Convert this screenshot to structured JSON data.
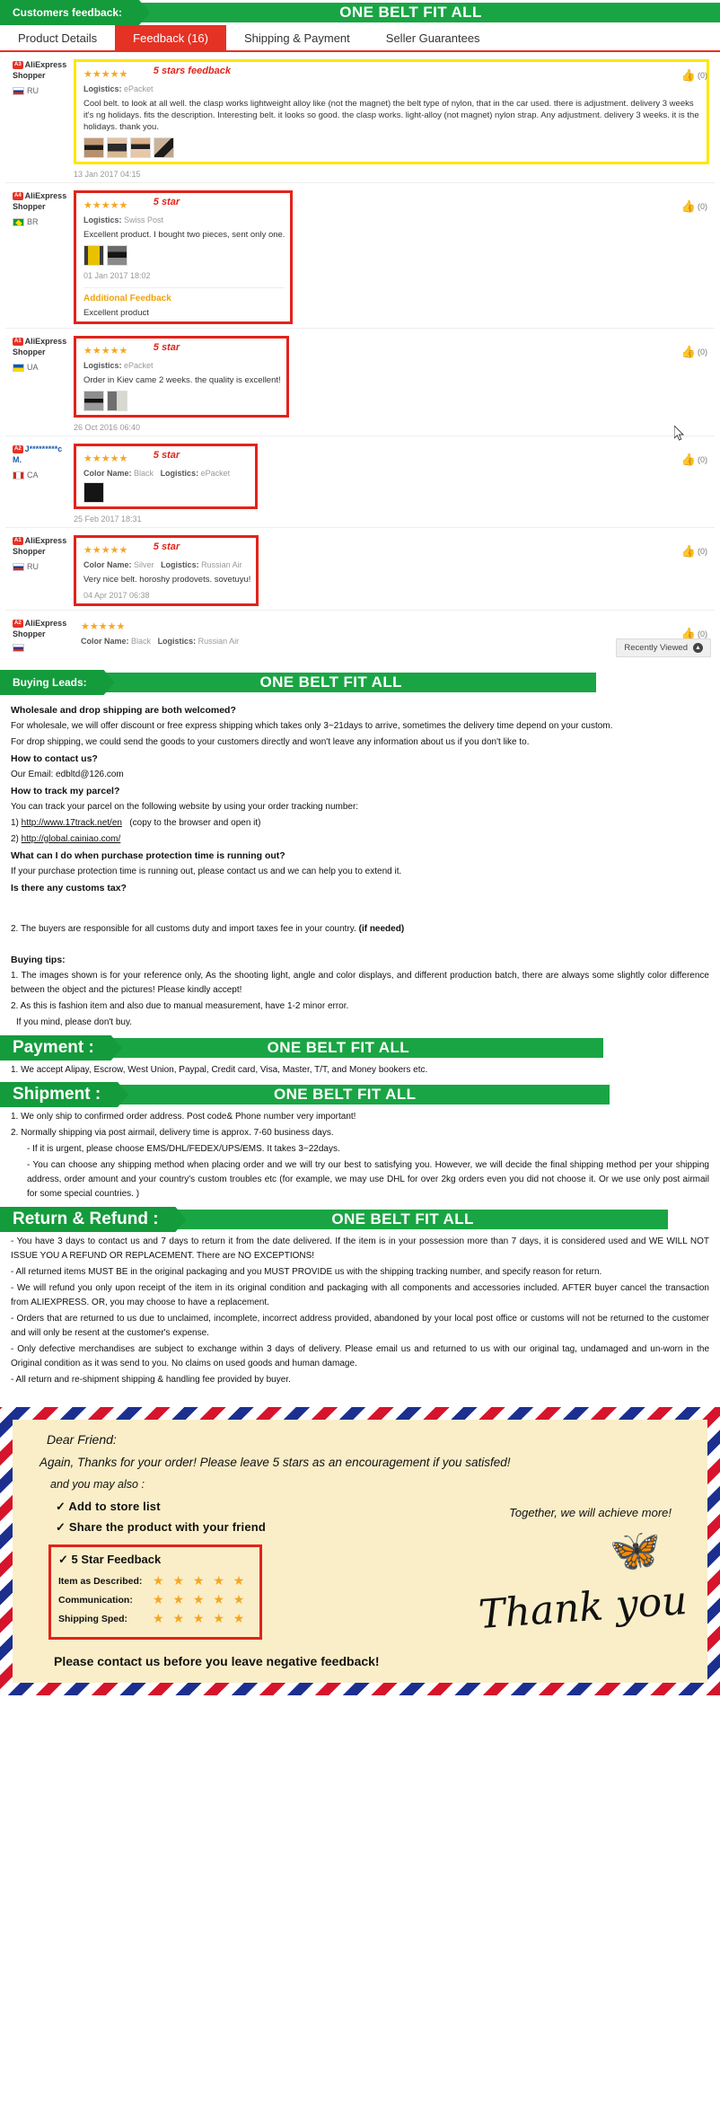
{
  "header": {
    "banner_label": "Customers feedback:",
    "banner_slogan": "ONE BELT FIT ALL"
  },
  "tabs": [
    {
      "label": "Product Details",
      "active": false
    },
    {
      "label": "Feedback (16)",
      "active": true
    },
    {
      "label": "Shipping & Payment",
      "active": false
    },
    {
      "label": "Seller Guarantees",
      "active": false
    }
  ],
  "feedback": [
    {
      "badge": "A3",
      "user": "AliExpress",
      "user2": "Shopper",
      "country": "RU",
      "flag": "flag-ru",
      "stars": "★★★★★",
      "note": "5 stars feedback",
      "meta_label": "Logistics:",
      "meta_value": "ePacket",
      "text": "Cool belt. to look at all well. the clasp works lightweight alloy like (not the magnet) the belt type of nylon, that in the car used. there is adjustment. delivery 3 weeks it's ng holidays. fits the description. Interesting belt. it looks so good. the clasp works. light-alloy (not magnet) nylon strap. Any adjustment. delivery 3 weeks. it is the holidays. thank you.",
      "date": "13 Jan 2017 04:15",
      "helpful": "(0)"
    },
    {
      "badge": "A4",
      "user": "AliExpress",
      "user2": "Shopper",
      "country": "BR",
      "flag": "flag-br",
      "stars": "★★★★★",
      "note": "5 star",
      "meta_label": "Logistics:",
      "meta_value": "Swiss Post",
      "text": "Excellent product. I bought two pieces, sent only one.",
      "date": "01 Jan 2017 18:02",
      "additional_label": "Additional Feedback",
      "additional_text": "Excellent product",
      "helpful": "(0)"
    },
    {
      "badge": "A1",
      "user": "AliExpress",
      "user2": "Shopper",
      "country": "UA",
      "flag": "flag-ua",
      "stars": "★★★★★",
      "note": "5 star",
      "meta_label": "Logistics:",
      "meta_value": "ePacket",
      "text": "Order in Kiev came 2 weeks. the quality is excellent!",
      "date": "26 Oct 2016 06:40",
      "helpful": "(0)"
    },
    {
      "badge": "A2",
      "user": "J*********c",
      "user2": "M.",
      "country": "CA",
      "flag": "flag-ca",
      "stars": "★★★★★",
      "note": "5 star",
      "meta_label": "Color Name:",
      "meta_value": "Black",
      "meta_label2": "Logistics:",
      "meta_value2": "ePacket",
      "text": "",
      "date": "25 Feb 2017 18:31",
      "helpful": "(0)"
    },
    {
      "badge": "A1",
      "user": "AliExpress",
      "user2": "Shopper",
      "country": "RU",
      "flag": "flag-ru",
      "stars": "★★★★★",
      "note": "5 star",
      "meta_label": "Color Name:",
      "meta_value": "Silver",
      "meta_label2": "Logistics:",
      "meta_value2": "Russian Air",
      "text": "Very nice belt. horoshy prodovets. sovetuyu!",
      "date": "04 Apr 2017 06:38",
      "helpful": "(0)"
    },
    {
      "badge": "A2",
      "user": "AliExpress",
      "user2": "Shopper",
      "country": "",
      "flag": "flag-ru",
      "stars": "★★★★★",
      "note": "",
      "meta_label": "Color Name:",
      "meta_value": "Black",
      "meta_label2": "Logistics:",
      "meta_value2": "Russian Air",
      "text": "",
      "date": "",
      "helpful": "(0)"
    }
  ],
  "recently_viewed": {
    "label": "Recently Viewed",
    "icon": "up-caret-circle"
  },
  "buying_leads": {
    "banner_label": "Buying Leads:",
    "banner_slogan": "ONE BELT FIT ALL",
    "q1": "Wholesale and drop shipping are both welcomed?",
    "p1": "For wholesale, we will offer discount or free express shipping which takes only 3~21days to arrive, sometimes the delivery time depend on your custom.",
    "p2": "For drop shipping, we could send the goods to your customers directly and won't leave any information about us if you don't like to.",
    "q2": "How to contact us?",
    "p3": "Our Email: edbltd@126.com",
    "q3": "How to track my parcel?",
    "p4": "You can track your parcel on the following website by using your order tracking number:",
    "link1_prefix": "1) ",
    "link1": "http://www.17track.net/en",
    "link1_suffix": "(copy to the browser and open it)",
    "link2_prefix": "2) ",
    "link2": "http://global.cainiao.com/",
    "q4": "What can I do when purchase protection time is running out?",
    "p5": "If your purchase protection time is running out, please contact us and we can help you to extend it.",
    "q5": "Is there any customs tax?",
    "p6": "2. The buyers are responsible for all customs duty and import taxes fee in your country.",
    "p6_bold": "(if needed)",
    "q6": "Buying tips:",
    "p7": "1. The images shown is for your reference only, As the shooting light, angle and color displays, and different production batch, there are always some slightly color difference between the object and the pictures! Please kindly accept!",
    "p8": "2. As this is fashion item and also due to manual measurement, have 1-2 minor error.",
    "p9": "If you mind, please don't buy."
  },
  "payment": {
    "banner_label": "Payment :",
    "banner_slogan": "ONE BELT FIT ALL",
    "p1": "1. We accept Alipay, Escrow, West Union, Paypal, Credit card, Visa, Master, T/T, and Money bookers etc."
  },
  "shipment": {
    "banner_label": "Shipment :",
    "banner_slogan": "ONE BELT FIT ALL",
    "p1": "1. We only ship to confirmed order address. Post code& Phone number very important!",
    "p2": "2. Normally shipping via post airmail, delivery time is approx. 7-60 business days.",
    "p3": "- If it is urgent, please choose EMS/DHL/FEDEX/UPS/EMS. It takes 3~22days.",
    "p4": "- You can choose any shipping method when placing order and we will try our best to satisfying you. However, we will decide the final shipping method per your shipping address, order amount and your country's custom troubles etc (for example, we may use DHL for over 2kg orders even you did not choose it. Or we use only post airmail for some special countries. )"
  },
  "return_refund": {
    "banner_label": "Return & Refund :",
    "banner_slogan": "ONE BELT FIT ALL",
    "p1": "- You have 3 days to contact us and 7 days to return it from the date delivered. If the item is in your possession more than 7 days, it is considered used and WE WILL NOT ISSUE YOU A REFUND OR REPLACEMENT. There are NO EXCEPTIONS!",
    "p2": "- All returned items MUST BE in the original packaging and you MUST PROVIDE us with the shipping tracking number, and specify reason for return.",
    "p3": "- We will refund you only upon receipt of the item in its original condition and packaging with all components and accessories included. AFTER buyer cancel the transaction from ALIEXPRESS. OR, you may choose to have a replacement.",
    "p4": "- Orders that are returned to us due to unclaimed, incomplete, incorrect address provided, abandoned by your local post office or customs will not be returned to the customer and will only be resent at the customer's expense.",
    "p5": "- Only defective merchandises are subject to exchange within 3 days of delivery. Please email us and returned to us with our original tag, undamaged and un-worn in the Original condition as it was send to you. No claims on used goods and human damage.",
    "p6": "- All return and re-shipment shipping & handling fee provided by buyer."
  },
  "airmail": {
    "line1": "Dear Friend:",
    "line2": "Again, Thanks for your order! Please leave 5 stars as an encouragement if you satisfed!",
    "line3": "and you may also :",
    "check1": "✓ Add to store list",
    "check2": "✓ Share the product with your friend",
    "box_header": "✓ 5 Star Feedback",
    "rates": [
      {
        "label": "Item as Described:",
        "stars": "★ ★ ★ ★ ★"
      },
      {
        "label": "Communication:",
        "stars": "★ ★ ★ ★ ★"
      },
      {
        "label": "Shipping Sped:",
        "stars": "★ ★ ★ ★ ★"
      }
    ],
    "together": "Together, we will achieve more!",
    "thank_you": "Thank you",
    "footer": "Please contact us before you leave negative feedback!"
  },
  "colors": {
    "green": "#149b3c",
    "red": "#e43225",
    "yellow_highlight": "#ffe600",
    "red_highlight": "#e2231a",
    "star_orange": "#f5a623",
    "airmail_paper": "#faeec8"
  }
}
